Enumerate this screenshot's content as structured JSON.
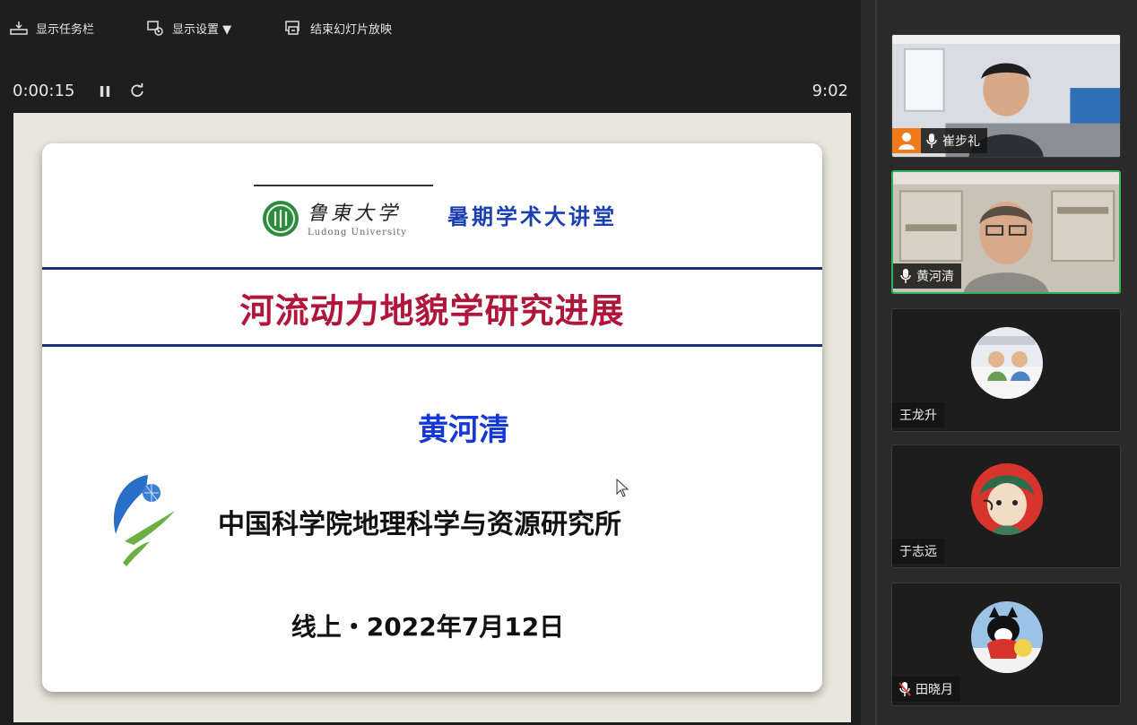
{
  "toolbar": {
    "show_taskbar": "显示任务栏",
    "display_settings": "显示设置 ▼",
    "end_slideshow": "结束幻灯片放映"
  },
  "timer": {
    "elapsed": "0:00:15",
    "clock": "9:02"
  },
  "slide": {
    "university_name": "鲁東大学",
    "university_name_en": "Ludong University",
    "lecture_series": "暑期学术大讲堂",
    "title": "河流动力地貌学研究进展",
    "speaker": "黄河清",
    "institution": "中国科学院地理科学与资源研究所",
    "date_line": "线上・2022年7月12日"
  },
  "participants": [
    {
      "name": "崔步礼",
      "mic": "on",
      "video": true
    },
    {
      "name": "黄河清",
      "mic": "on",
      "video": true,
      "active": true
    },
    {
      "name": "王龙升",
      "mic": "none",
      "video": false
    },
    {
      "name": "于志远",
      "mic": "none",
      "video": false
    },
    {
      "name": "田晓月",
      "mic": "muted",
      "video": false
    }
  ],
  "colors": {
    "title_red": "#b0163a",
    "speaker_blue": "#1638d8",
    "rule_navy": "#1c2f7a",
    "active_speaker_border": "#2fb35a",
    "host_badge": "#f07a1a"
  },
  "icons": {
    "taskbar": "taskbar-icon",
    "display": "display-settings-icon",
    "end": "end-slideshow-icon",
    "pause": "pause-icon",
    "reset": "reset-icon",
    "mic": "microphone-icon",
    "mic_muted": "microphone-muted-icon",
    "host": "host-icon"
  }
}
